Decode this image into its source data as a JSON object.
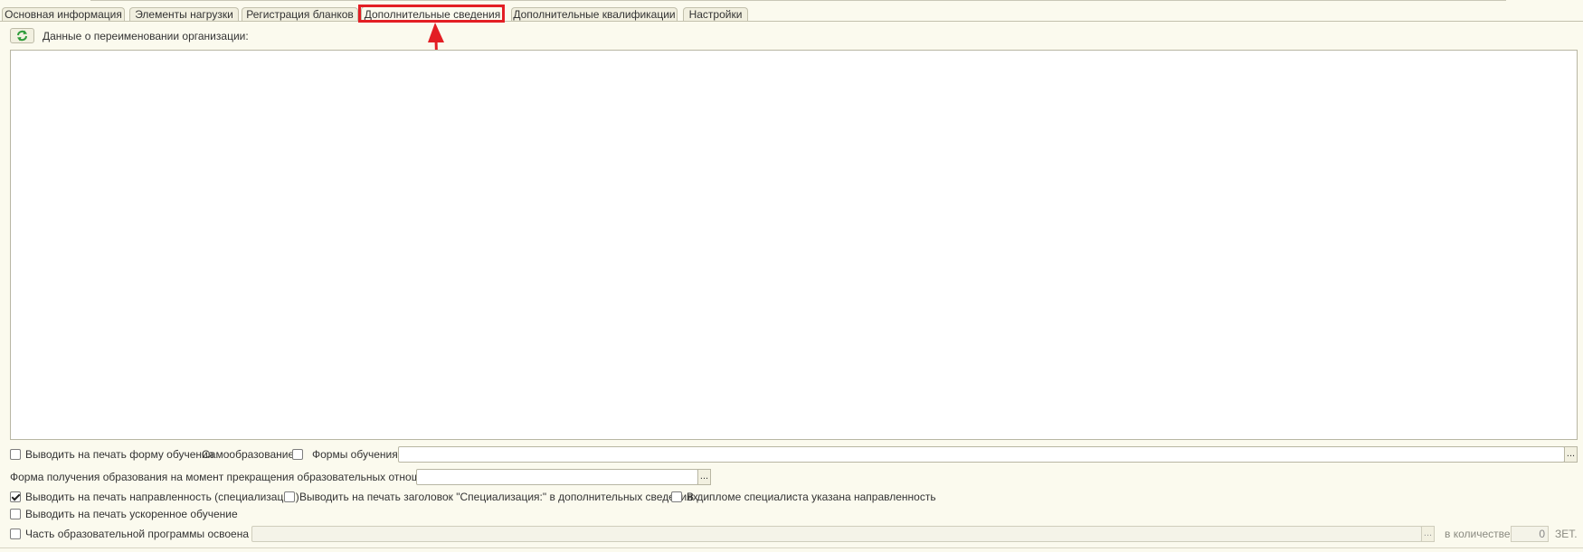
{
  "tabs": [
    {
      "label": "Основная информация"
    },
    {
      "label": "Элементы нагрузки"
    },
    {
      "label": "Регистрация бланков"
    },
    {
      "label": "Дополнительные сведения"
    },
    {
      "label": "Дополнительные квалификации"
    },
    {
      "label": "Настройки"
    }
  ],
  "active_tab": "Дополнительные сведения",
  "rename": {
    "label": "Данные о переименовании организации:"
  },
  "form": {
    "print_form_label": "Выводить на печать форму обучения",
    "print_form_checked": false,
    "self_education_label": "Самообразование:",
    "self_education_checked": false,
    "forms_label": "Формы обучения:",
    "forms_value": "",
    "edu_form_label": "Форма получения образования на момент прекращения образовательных отношений:",
    "edu_form_value": "",
    "print_direction_label": "Выводить на печать направленность (специализации)",
    "print_direction_checked": true,
    "print_header_label": "Выводить на печать заголовок \"Специализация:\" в дополнительных сведениях",
    "print_header_checked": false,
    "diploma_direction_label": "В дипломе специалиста указана направленность",
    "diploma_direction_checked": false,
    "accelerated_label": "Выводить на печать ускоренное обучение",
    "accelerated_checked": false,
    "part_program_label": "Часть образовательной программы освоена в:",
    "part_program_checked": false,
    "part_program_value": "",
    "quantity_label": "в количестве:",
    "quantity_value": "0",
    "unit_label": "ЗЕТ.",
    "dots": "..."
  },
  "colors": {
    "background": "#fbfaee",
    "highlight": "#e31e24",
    "refresh_icon": "#2e9b3a"
  }
}
